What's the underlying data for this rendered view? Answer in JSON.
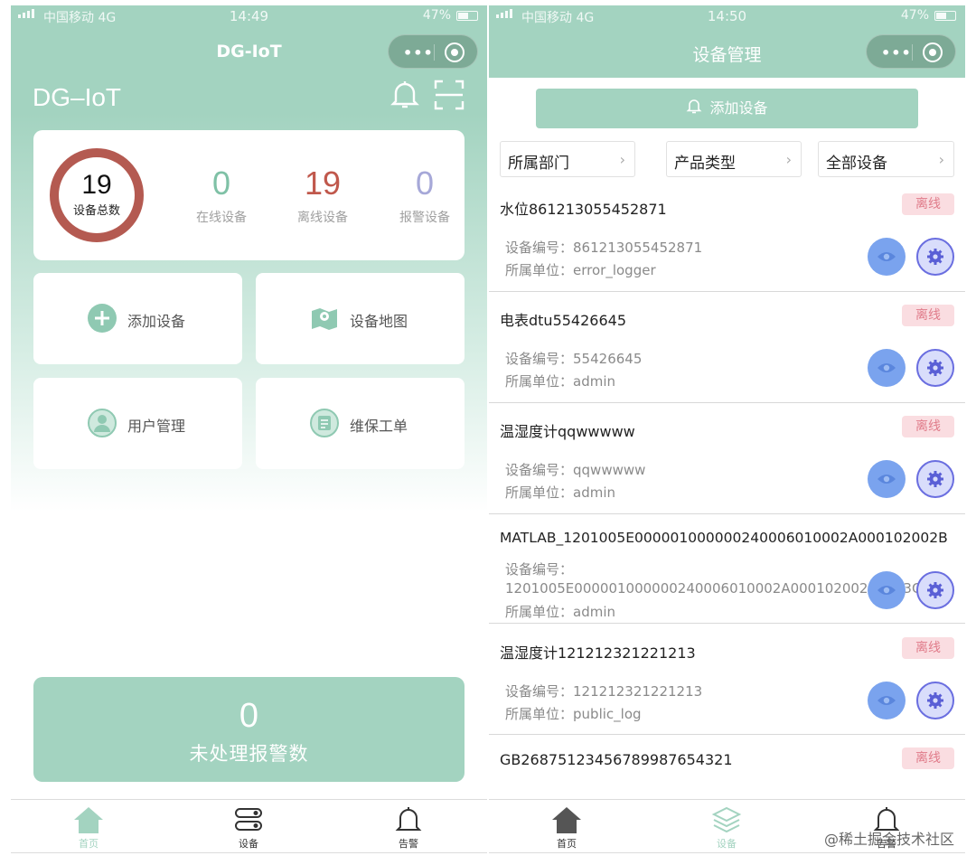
{
  "left": {
    "status": {
      "carrier": "中国移动  4G",
      "time": "14:49",
      "battery": "47%"
    },
    "nav_title": "DG-IoT",
    "brand": "DG–IoT",
    "stats": {
      "total": {
        "value": "19",
        "label": "设备总数"
      },
      "online": {
        "value": "0",
        "label": "在线设备"
      },
      "offline": {
        "value": "19",
        "label": "离线设备"
      },
      "alarm": {
        "value": "0",
        "label": "报警设备"
      }
    },
    "functions": [
      {
        "label": "添加设备",
        "icon": "add-circle-icon"
      },
      {
        "label": "设备地图",
        "icon": "map-icon"
      },
      {
        "label": "用户管理",
        "icon": "user-icon"
      },
      {
        "label": "维保工单",
        "icon": "work-order-icon"
      }
    ],
    "alarm_card": {
      "value": "0",
      "label": "未处理报警数"
    },
    "tabs": [
      {
        "label": "首页",
        "icon": "home-icon",
        "active": true
      },
      {
        "label": "设备",
        "icon": "device-icon",
        "active": false
      },
      {
        "label": "告警",
        "icon": "bell-icon",
        "active": false
      }
    ]
  },
  "right": {
    "status": {
      "carrier": "中国移动  4G",
      "time": "14:50",
      "battery": "47%"
    },
    "nav_title": "设备管理",
    "add_button": "添加设备",
    "filters": [
      "所属部门",
      "产品类型",
      "全部设备"
    ],
    "labels": {
      "code": "设备编号：",
      "unit": "所属单位："
    },
    "devices": [
      {
        "name": "水位861213055452871",
        "status": "离线",
        "code": "861213055452871",
        "unit": "error_logger"
      },
      {
        "name": "电表dtu55426645",
        "status": "离线",
        "code": "55426645",
        "unit": "admin"
      },
      {
        "name": "温湿度计qqwwwww",
        "status": "离线",
        "code": "qqwwwww",
        "unit": "admin"
      },
      {
        "name": "MATLAB_1201005E000001000000240006010002A000102002B",
        "status": "",
        "code": "1201005E000001000000240006010002A000102002B0003C0",
        "unit": "admin"
      },
      {
        "name": "温湿度计121212321221213",
        "status": "离线",
        "code": "121212321221213",
        "unit": "public_log"
      },
      {
        "name": "GB26875123456789987654321",
        "status": "离线",
        "code": "",
        "unit": ""
      }
    ],
    "tabs": [
      {
        "label": "首页",
        "icon": "home-icon",
        "active": false
      },
      {
        "label": "设备",
        "icon": "layers-icon",
        "active": true
      },
      {
        "label": "告警",
        "icon": "bell-icon",
        "active": false
      }
    ]
  },
  "watermark": "@稀土掘金技术社区",
  "colors": {
    "accent": "#a3d3c0",
    "ring": "#b45a51",
    "online": "#7fc1a6",
    "offline": "#c0584c",
    "alarm": "#a6a8d8",
    "offline_badge_bg": "#fadde1",
    "eye_button": "#7aa3ee",
    "settings_button": "#6a6ee0"
  }
}
